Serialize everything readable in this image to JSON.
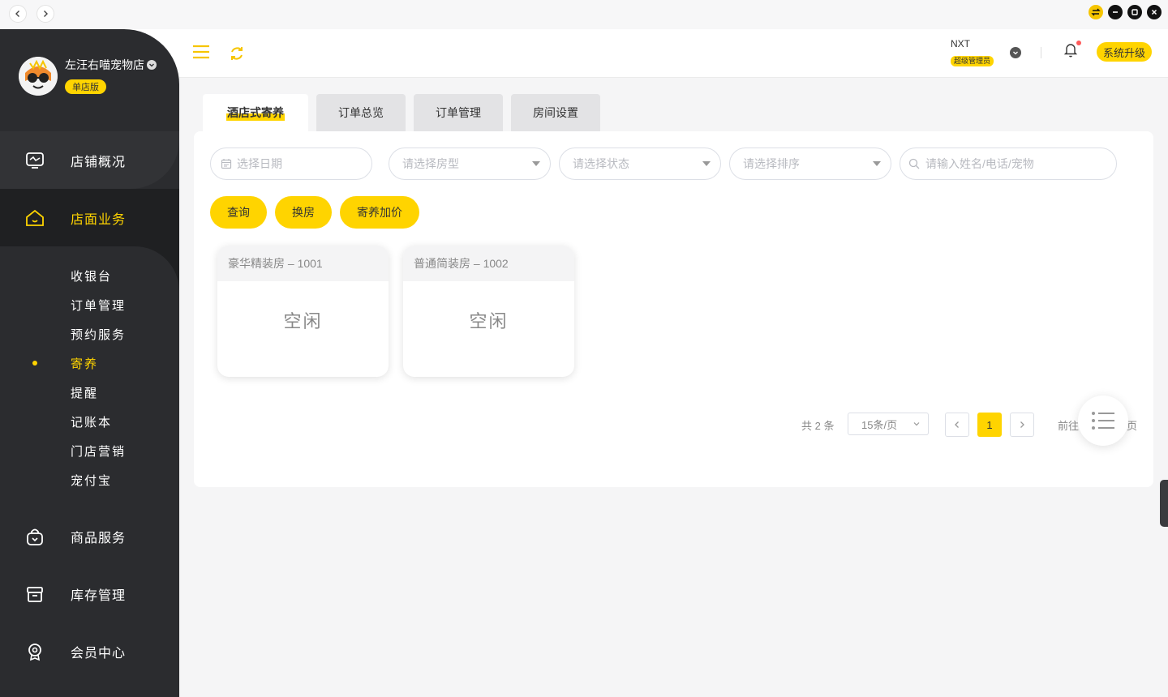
{
  "shop": {
    "name": "左汪右喵宠物店",
    "edition": "单店版"
  },
  "sidebar": {
    "items": [
      {
        "label": "店铺概况",
        "icon": "dashboard-icon"
      },
      {
        "label": "店面业务",
        "icon": "home-icon"
      },
      {
        "label": "商品服务",
        "icon": "bag-icon"
      },
      {
        "label": "库存管理",
        "icon": "box-icon"
      },
      {
        "label": "会员中心",
        "icon": "member-icon"
      }
    ],
    "sub_items": [
      "收银台",
      "订单管理",
      "预约服务",
      "寄养",
      "提醒",
      "记账本",
      "门店营销",
      "宠付宝"
    ],
    "active_sub": "寄养"
  },
  "header": {
    "user": "NXT",
    "role": "超级管理员",
    "upgrade_label": "系统升级"
  },
  "tabs": [
    "酒店式寄养",
    "订单总览",
    "订单管理",
    "房间设置"
  ],
  "filters": {
    "date_placeholder": "选择日期",
    "room_type_placeholder": "请选择房型",
    "status_placeholder": "请选择状态",
    "sort_placeholder": "请选择排序",
    "search_placeholder": "请输入姓名/电话/宠物"
  },
  "actions": {
    "query": "查询",
    "change_room": "换房",
    "surcharge": "寄养加价"
  },
  "rooms": [
    {
      "title": "豪华精装房 – 1001",
      "status": "空闲"
    },
    {
      "title": "普通简装房 – 1002",
      "status": "空闲"
    }
  ],
  "pagination": {
    "total": "共 2 条",
    "page_size": "15条/页",
    "current_page": "1",
    "goto_label": "前往",
    "page_suffix": "页"
  },
  "colors": {
    "accent": "#ffd400",
    "sidebar": "#2b2c2f"
  }
}
